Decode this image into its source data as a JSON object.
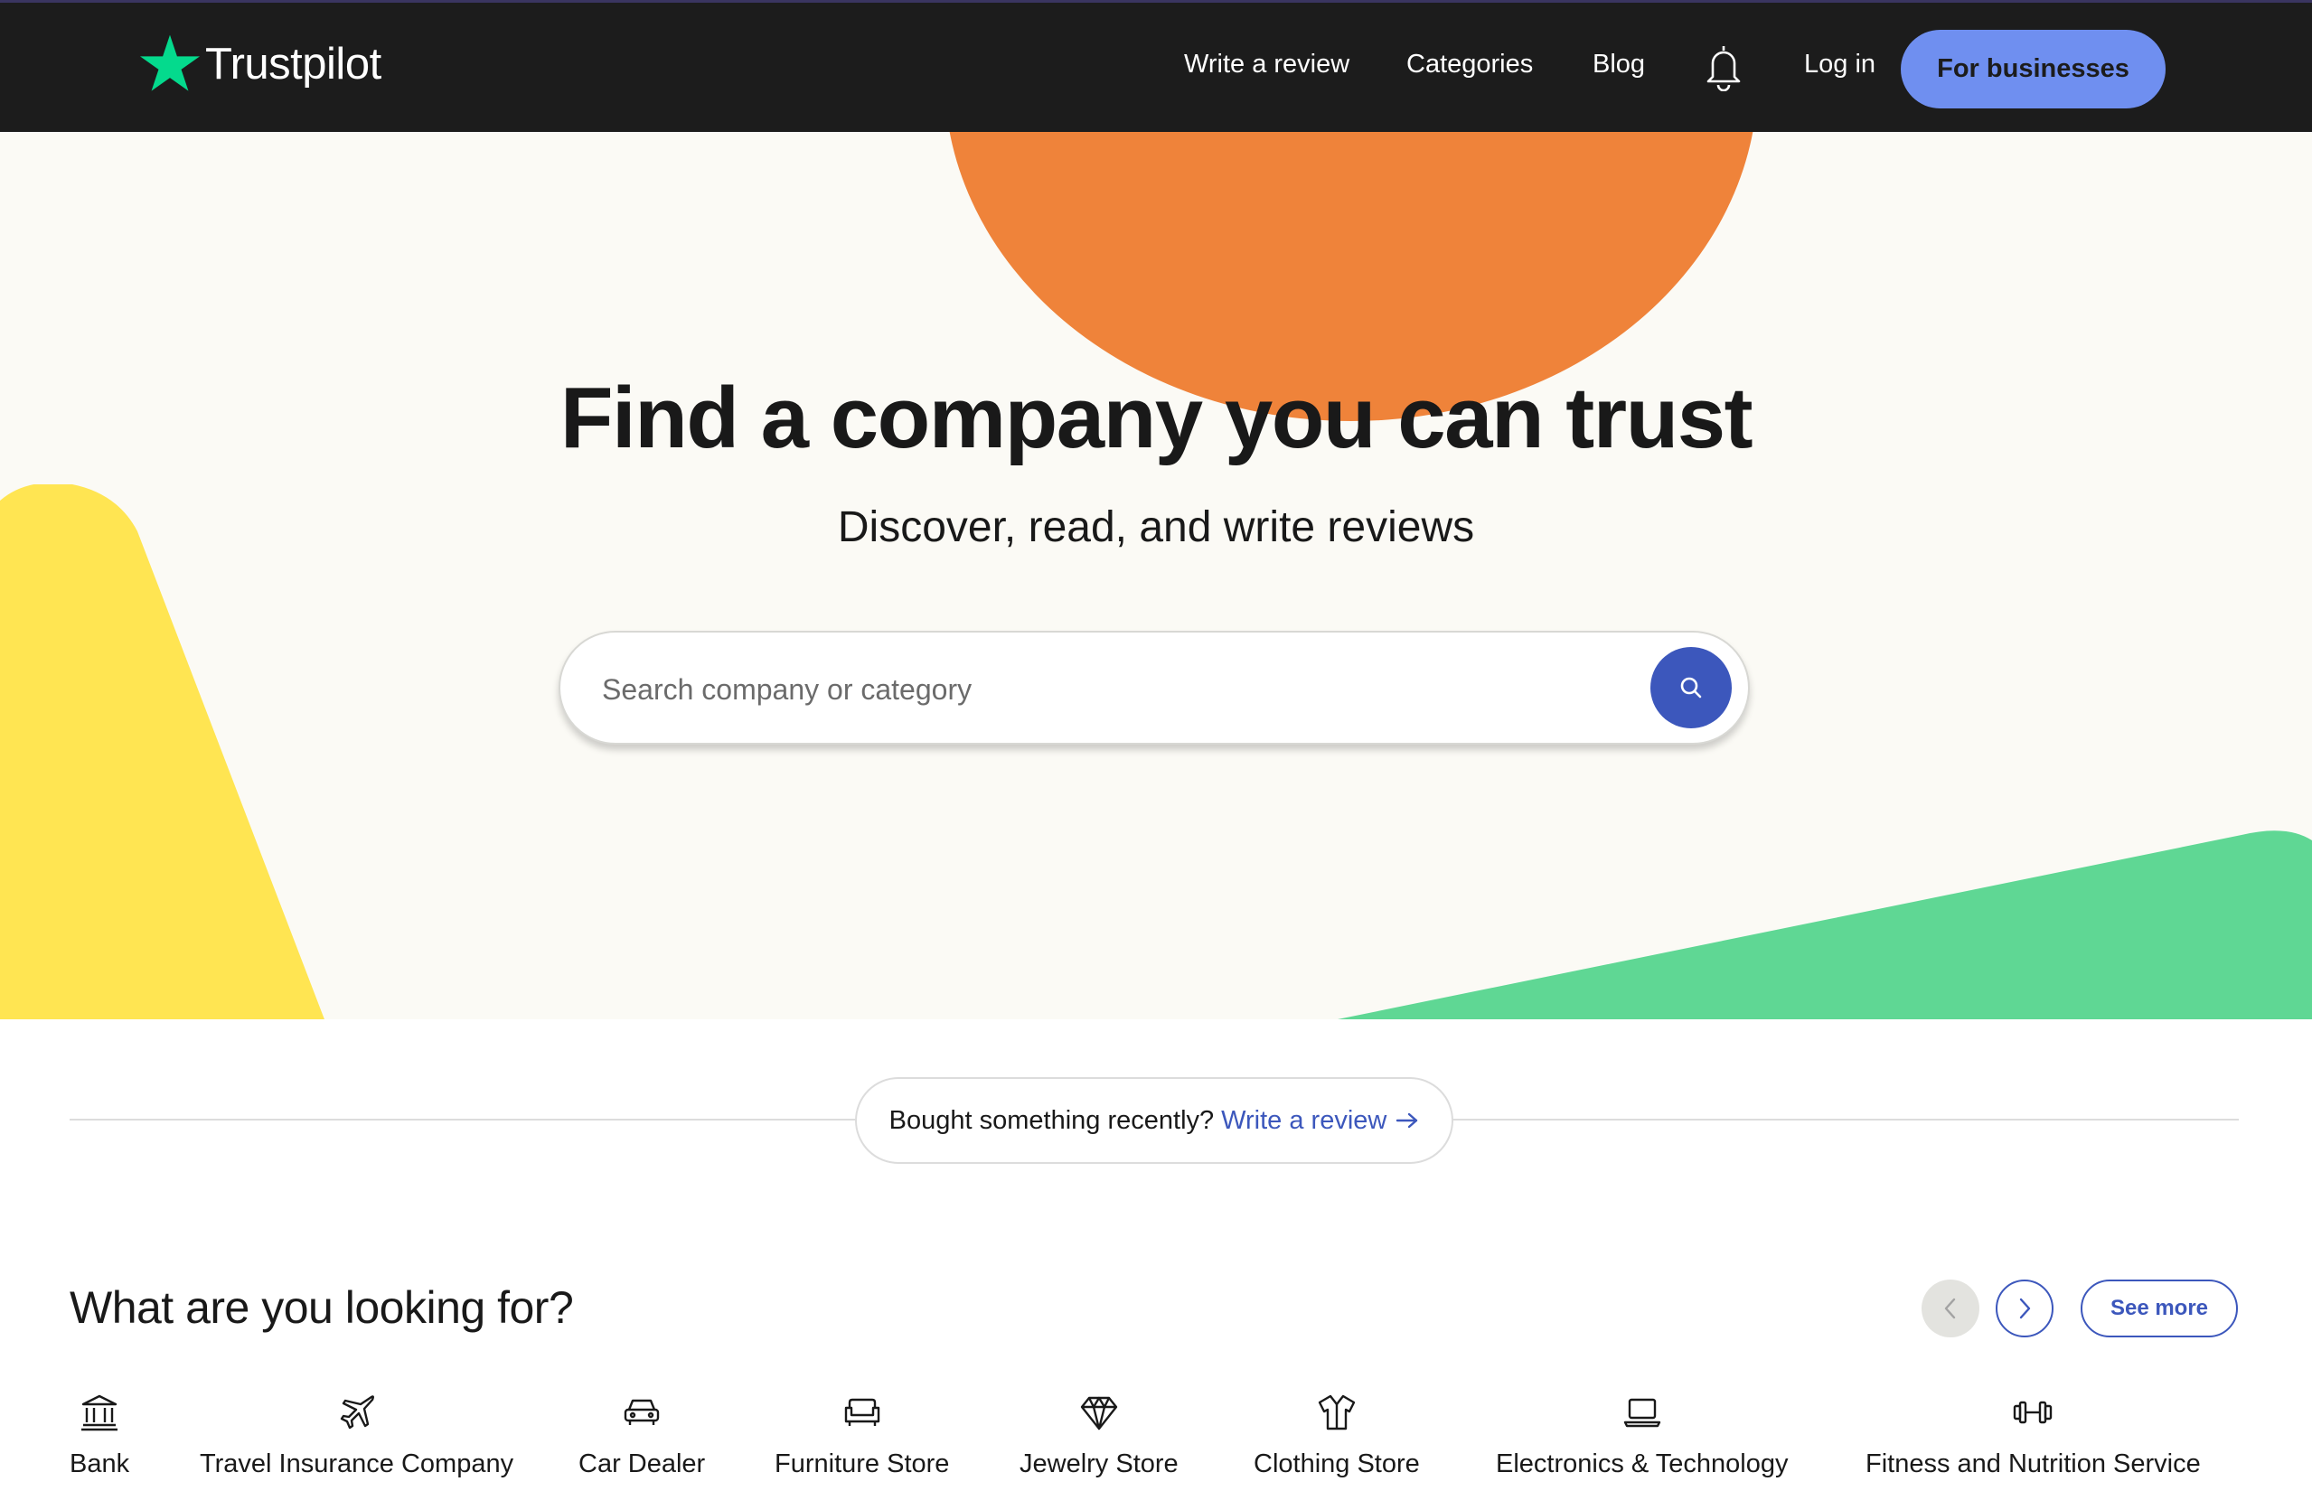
{
  "brand": {
    "name": "Trustpilot",
    "star_color": "#04da8d"
  },
  "nav": {
    "write_review": "Write a review",
    "categories": "Categories",
    "blog": "Blog",
    "login": "Log in",
    "for_businesses": "For businesses"
  },
  "hero": {
    "title": "Find a company you can trust",
    "subtitle": "Discover, read, and write reviews",
    "search_placeholder": "Search company or category",
    "search_value": ""
  },
  "review_prompt": {
    "question": "Bought something recently?",
    "link": "Write a review"
  },
  "categories": {
    "heading": "What are you looking for?",
    "see_more": "See more",
    "items": [
      {
        "label": "Bank",
        "icon": "bank-icon"
      },
      {
        "label": "Travel Insurance Company",
        "icon": "airplane-icon"
      },
      {
        "label": "Car Dealer",
        "icon": "car-icon"
      },
      {
        "label": "Furniture Store",
        "icon": "sofa-icon"
      },
      {
        "label": "Jewelry Store",
        "icon": "diamond-icon"
      },
      {
        "label": "Clothing Store",
        "icon": "shirt-icon"
      },
      {
        "label": "Electronics & Technology",
        "icon": "laptop-icon"
      },
      {
        "label": "Fitness and Nutrition Service",
        "icon": "dumbbell-icon"
      }
    ]
  },
  "colors": {
    "header_bg": "#1c1c1c",
    "accent_blue": "#3c57bc",
    "business_button": "#6f8ff0",
    "hero_bg": "#fbfaf5",
    "shape_orange": "#ef833a",
    "shape_yellow": "#ffe552",
    "shape_green": "#5fd794"
  }
}
